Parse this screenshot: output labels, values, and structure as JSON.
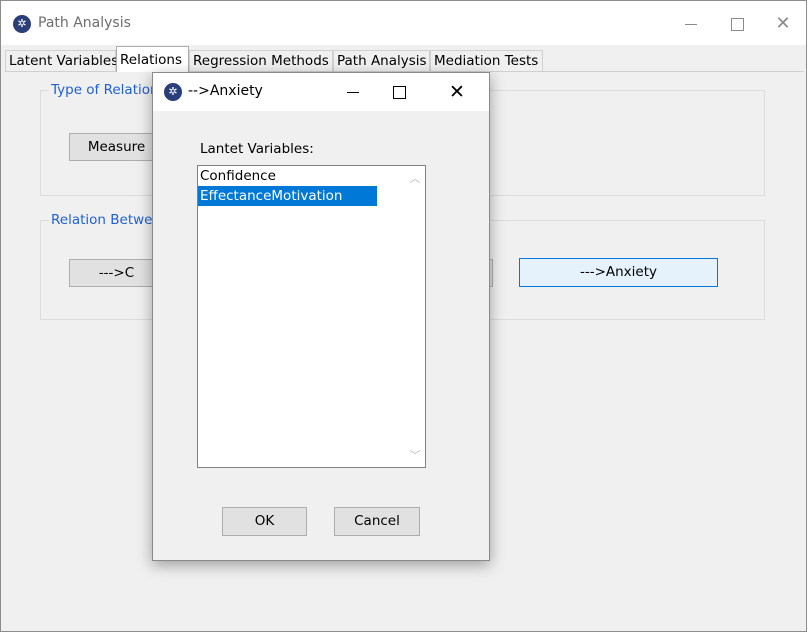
{
  "main_window": {
    "title": "Path Analysis",
    "controls": {
      "minimize": "—",
      "maximize": "☐",
      "close": "✕"
    }
  },
  "tabs": [
    "Latent Variables",
    "Relations",
    "Regression Methods",
    "Path Analysis",
    "Mediation Tests"
  ],
  "active_tab": "Relations",
  "groups": {
    "type_of_relation": {
      "title": "Type of Relation",
      "button_visible": "Measure"
    },
    "relation_between": {
      "title": "Relation Betwee",
      "button_left_visible": "--->C",
      "button_right": "--->Anxiety"
    }
  },
  "dialog": {
    "title": "-->Anxiety",
    "controls": {
      "minimize": "—",
      "maximize": "☐",
      "close": "✕"
    },
    "list_label": "Lantet Variables:",
    "list_items": [
      "Confidence",
      "EffectanceMotivation"
    ],
    "selected_item": "EffectanceMotivation",
    "ok_label": "OK",
    "cancel_label": "Cancel"
  },
  "icons": {
    "app": "app-logo-icon",
    "scroll_up": "chevron-up-icon",
    "scroll_down": "chevron-down-icon"
  },
  "colors": {
    "group_title": "#1f5fd6",
    "selection": "#0078d7",
    "highlight_button_border": "#0078d7"
  }
}
